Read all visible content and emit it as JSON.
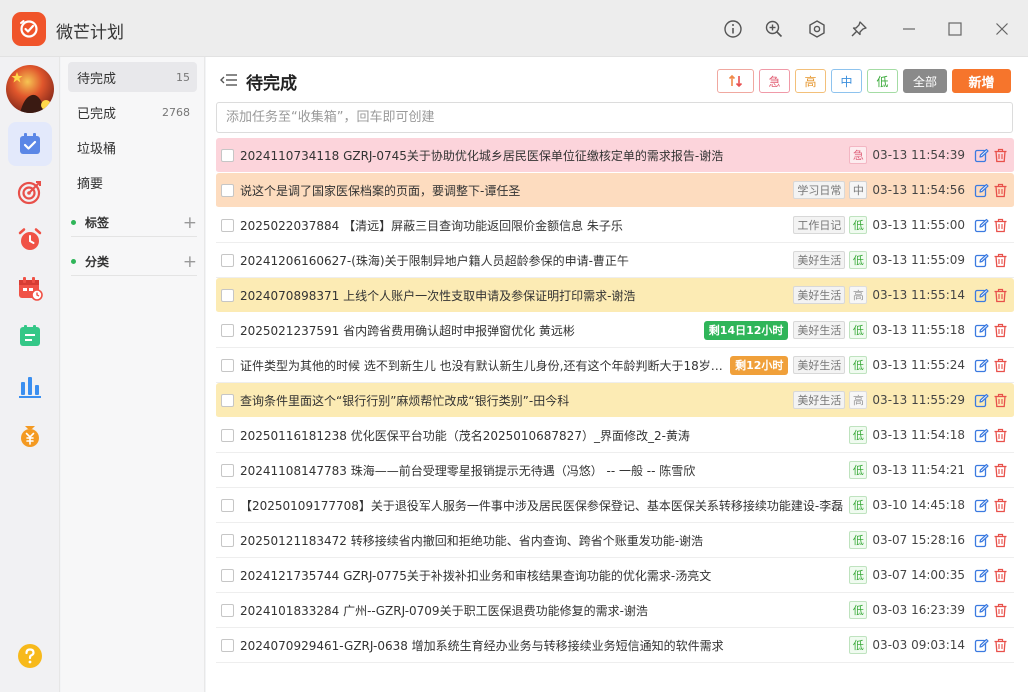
{
  "app": {
    "title": "微芒计划"
  },
  "colors": {
    "accent": "#4f7bd4",
    "primary_button": "#f6752c",
    "logo": "#f0542a"
  },
  "window_icons": [
    "info-icon",
    "zoom-icon",
    "settings-icon",
    "pin-icon",
    "minimize-icon",
    "maximize-icon",
    "close-icon"
  ],
  "icon_bar": [
    "todo-icon",
    "target-icon",
    "alarm-icon",
    "calendar-icon",
    "notes-icon",
    "stats-icon",
    "money-icon",
    "help-icon"
  ],
  "sidebar": {
    "items": [
      {
        "label": "待完成",
        "count": "15"
      },
      {
        "label": "已完成",
        "count": "2768"
      },
      {
        "label": "垃圾桶",
        "count": ""
      },
      {
        "label": "摘要",
        "count": ""
      }
    ],
    "groups": [
      {
        "label": "标签"
      },
      {
        "label": "分类"
      }
    ]
  },
  "header": {
    "title": "待完成"
  },
  "filters": {
    "urgent": "急",
    "high": "高",
    "mid": "中",
    "low": "低",
    "all": "全部",
    "new": "新增"
  },
  "search": {
    "placeholder": "添加任务至“收集箱”，回车即可创建"
  },
  "tasks": [
    {
      "text": "2024110734118 GZRJ-0745关于协助优化城乡居民医保单位征缴核定单的需求报告-谢浩",
      "due": "",
      "tag": "",
      "priority": "急",
      "time": "03-13 11:54:39"
    },
    {
      "text": "说这个是调了国家医保档案的页面，要调整下-谭任圣",
      "due": "",
      "tag": "学习日常",
      "priority": "中",
      "time": "03-13 11:54:56"
    },
    {
      "text": "2025022037884 【清远】屏蔽三目查询功能返回限价金额信息 朱子乐",
      "due": "",
      "tag": "工作日记",
      "priority": "低",
      "time": "03-13 11:55:00"
    },
    {
      "text": "20241206160627-(珠海)关于限制异地户籍人员超龄参保的申请-曹正午",
      "due": "",
      "tag": "美好生活",
      "priority": "低",
      "time": "03-13 11:55:09"
    },
    {
      "text": "2024070898371 上线个人账户一次性支取申请及参保证明打印需求-谢浩",
      "due": "",
      "tag": "美好生活",
      "priority": "高",
      "time": "03-13 11:55:14"
    },
    {
      "text": "2025021237591 省内跨省费用确认超时申报弹窗优化 黄远彬",
      "due": "剩14日12小时",
      "tag": "美好生活",
      "priority": "低",
      "time": "03-13 11:55:18"
    },
    {
      "text": "证件类型为其他的时候 选不到新生儿 也没有默认新生儿身份,还有这个年龄判断大于18岁的 ...",
      "due": "剩12小时",
      "tag": "美好生活",
      "priority": "低",
      "time": "03-13 11:55:24"
    },
    {
      "text": "查询条件里面这个“银行行别”麻烦帮忙改成“银行类别”-田今科",
      "due": "",
      "tag": "美好生活",
      "priority": "高",
      "time": "03-13 11:55:29"
    },
    {
      "text": "20250116181238 优化医保平台功能（茂名2025010687827）_界面修改_2-黄涛",
      "due": "",
      "tag": "",
      "priority": "低",
      "time": "03-13 11:54:18"
    },
    {
      "text": "20241108147783 珠海——前台受理零星报销提示无待遇（冯悠） -- 一般 -- 陈雪欣",
      "due": "",
      "tag": "",
      "priority": "低",
      "time": "03-13 11:54:21"
    },
    {
      "text": "【20250109177708】关于退役军人服务一件事中涉及居民医保参保登记、基本医保关系转移接续功能建设-李磊",
      "due": "",
      "tag": "",
      "priority": "低",
      "time": "03-10 14:45:18"
    },
    {
      "text": "20250121183472 转移接续省内撤回和拒绝功能、省内查询、跨省个账重发功能-谢浩",
      "due": "",
      "tag": "",
      "priority": "低",
      "time": "03-07 15:28:16"
    },
    {
      "text": "2024121735744 GZRJ-0775关于补拨补扣业务和审核结果查询功能的优化需求-汤亮文",
      "due": "",
      "tag": "",
      "priority": "低",
      "time": "03-07 14:00:35"
    },
    {
      "text": "2024101833284 广州--GZRJ-0709关于职工医保退费功能修复的需求-谢浩",
      "due": "",
      "tag": "",
      "priority": "低",
      "time": "03-03 16:23:39"
    },
    {
      "text": "2024070929461-GZRJ-0638 增加系统生育经办业务与转移接续业务短信通知的软件需求",
      "due": "",
      "tag": "",
      "priority": "低",
      "time": "03-03 09:03:14"
    }
  ]
}
